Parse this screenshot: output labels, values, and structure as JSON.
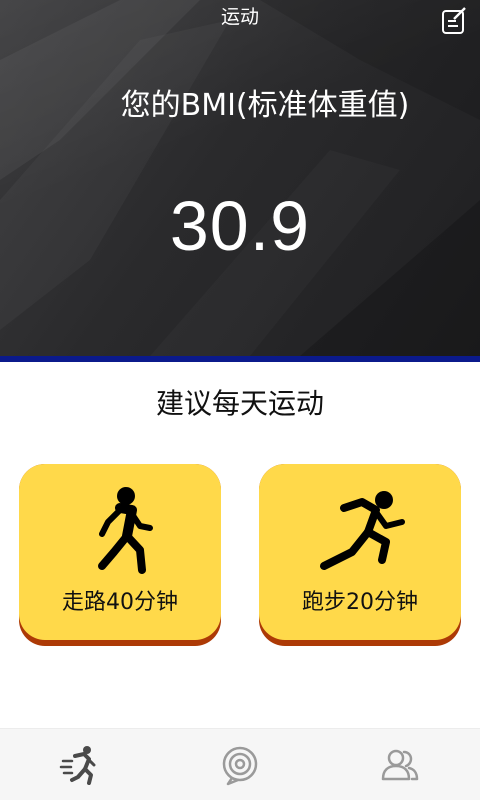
{
  "header": {
    "title": "运动",
    "bmi_label": "您的BMI(标准体重值)",
    "bmi_value": "30.9"
  },
  "suggestion": {
    "title": "建议每天运动",
    "cards": [
      {
        "label": "走路40分钟",
        "icon": "walking-person-icon"
      },
      {
        "label": "跑步20分钟",
        "icon": "running-person-icon"
      }
    ]
  },
  "nav": {
    "items": [
      {
        "icon": "running-icon",
        "active": true
      },
      {
        "icon": "target-icon",
        "active": false
      },
      {
        "icon": "users-icon",
        "active": false
      }
    ]
  },
  "colors": {
    "header_strip": "#0b1a8c",
    "card_face": "#ffd94a",
    "card_shadow": "#ad3a06",
    "nav_active": "#4a4a4a",
    "nav_inactive": "#9a9a9a"
  }
}
